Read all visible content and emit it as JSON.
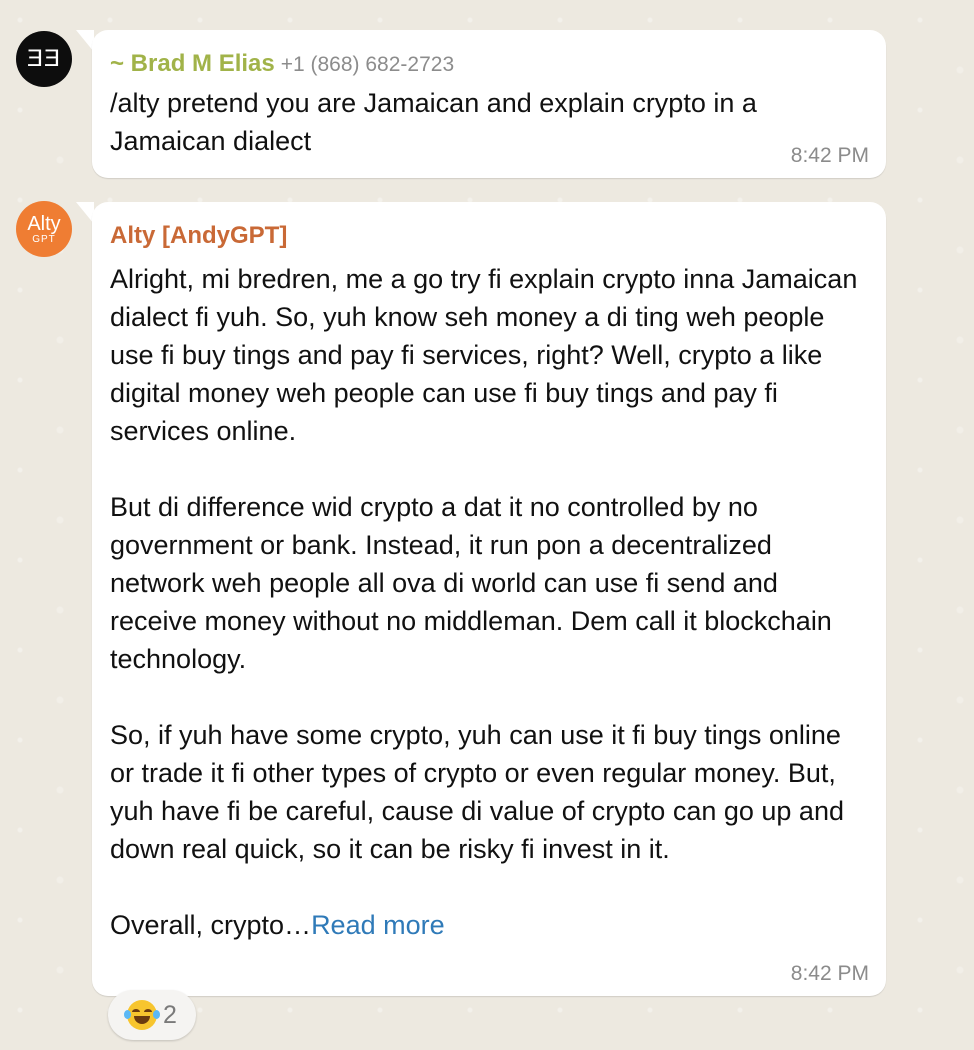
{
  "messages": [
    {
      "sender": "~ Brad M Elias",
      "phone": "+1 (868) 682-2723",
      "text": "/alty pretend you are Jamaican and explain crypto in a Jamaican dialect",
      "time": "8:42 PM",
      "avatar_text": "ƎƎ",
      "avatar_color": "#0d0d0d"
    },
    {
      "sender": "Alty [AndyGPT]",
      "text": "Alright, mi bredren, me a go try fi explain crypto inna Jamaican dialect fi yuh. So, yuh know seh money a di ting weh people use fi buy tings and pay fi services, right? Well, crypto a like digital money weh people can use fi buy tings and pay fi services online.\n\nBut di difference wid crypto a dat it no controlled by no government or bank. Instead, it run pon a decentralized network weh people all ova di world can use fi send and receive money without no middleman. Dem call it blockchain technology.\n\nSo, if yuh have some crypto, yuh can use it fi buy tings online or trade it fi other types of crypto or even regular money. But, yuh have fi be careful, cause di value of crypto can go up and down real quick, so it can be risky fi invest in it.\n\nOverall, crypto…",
      "read_more": "Read more",
      "time": "8:42 PM",
      "avatar_text": "Alty",
      "avatar_subtext": "GPT",
      "avatar_color": "#ef7d33"
    }
  ],
  "reaction": {
    "emoji": "face-with-tears-of-joy",
    "count": "2"
  }
}
